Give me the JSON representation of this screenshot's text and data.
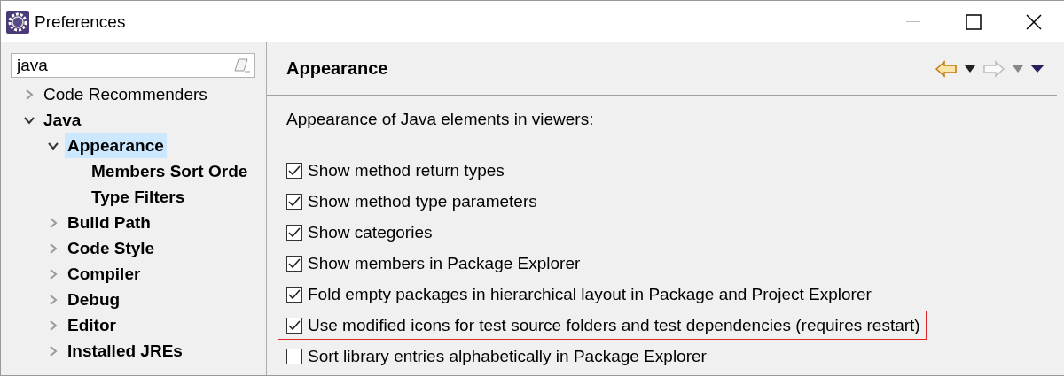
{
  "window": {
    "title": "Preferences"
  },
  "filter": {
    "value": "java"
  },
  "tree": [
    {
      "label": "Code Recommenders",
      "matched": false,
      "expanded": false,
      "selected": false
    },
    {
      "label": "Java",
      "matched": true,
      "expanded": true,
      "selected": false,
      "children": [
        {
          "label": "Appearance",
          "matched": true,
          "expanded": true,
          "selected": true,
          "children": [
            {
              "label": "Members Sort Orde",
              "matched": true,
              "selected": false
            },
            {
              "label": "Type Filters",
              "matched": true,
              "selected": false
            }
          ]
        },
        {
          "label": "Build Path",
          "matched": true,
          "expanded": false,
          "selected": false
        },
        {
          "label": "Code Style",
          "matched": true,
          "expanded": false,
          "selected": false
        },
        {
          "label": "Compiler",
          "matched": true,
          "expanded": false,
          "selected": false
        },
        {
          "label": "Debug",
          "matched": true,
          "expanded": false,
          "selected": false
        },
        {
          "label": "Editor",
          "matched": true,
          "expanded": false,
          "selected": false
        },
        {
          "label": "Installed JREs",
          "matched": true,
          "expanded": false,
          "selected": false
        }
      ]
    }
  ],
  "page": {
    "title": "Appearance",
    "description": "Appearance of Java elements in viewers:",
    "options": [
      {
        "label": "Show method return types",
        "checked": true,
        "highlighted": false
      },
      {
        "label": "Show method type parameters",
        "checked": true,
        "highlighted": false
      },
      {
        "label": "Show categories",
        "checked": true,
        "highlighted": false
      },
      {
        "label": "Show members in Package Explorer",
        "checked": true,
        "highlighted": false
      },
      {
        "label": "Fold empty packages in hierarchical layout in Package and Project Explorer",
        "checked": true,
        "highlighted": false
      },
      {
        "label": "Use modified icons for test source folders and test dependencies (requires restart)",
        "checked": true,
        "highlighted": true
      },
      {
        "label": "Sort library entries alphabetically in Package Explorer",
        "checked": false,
        "highlighted": false
      }
    ]
  }
}
